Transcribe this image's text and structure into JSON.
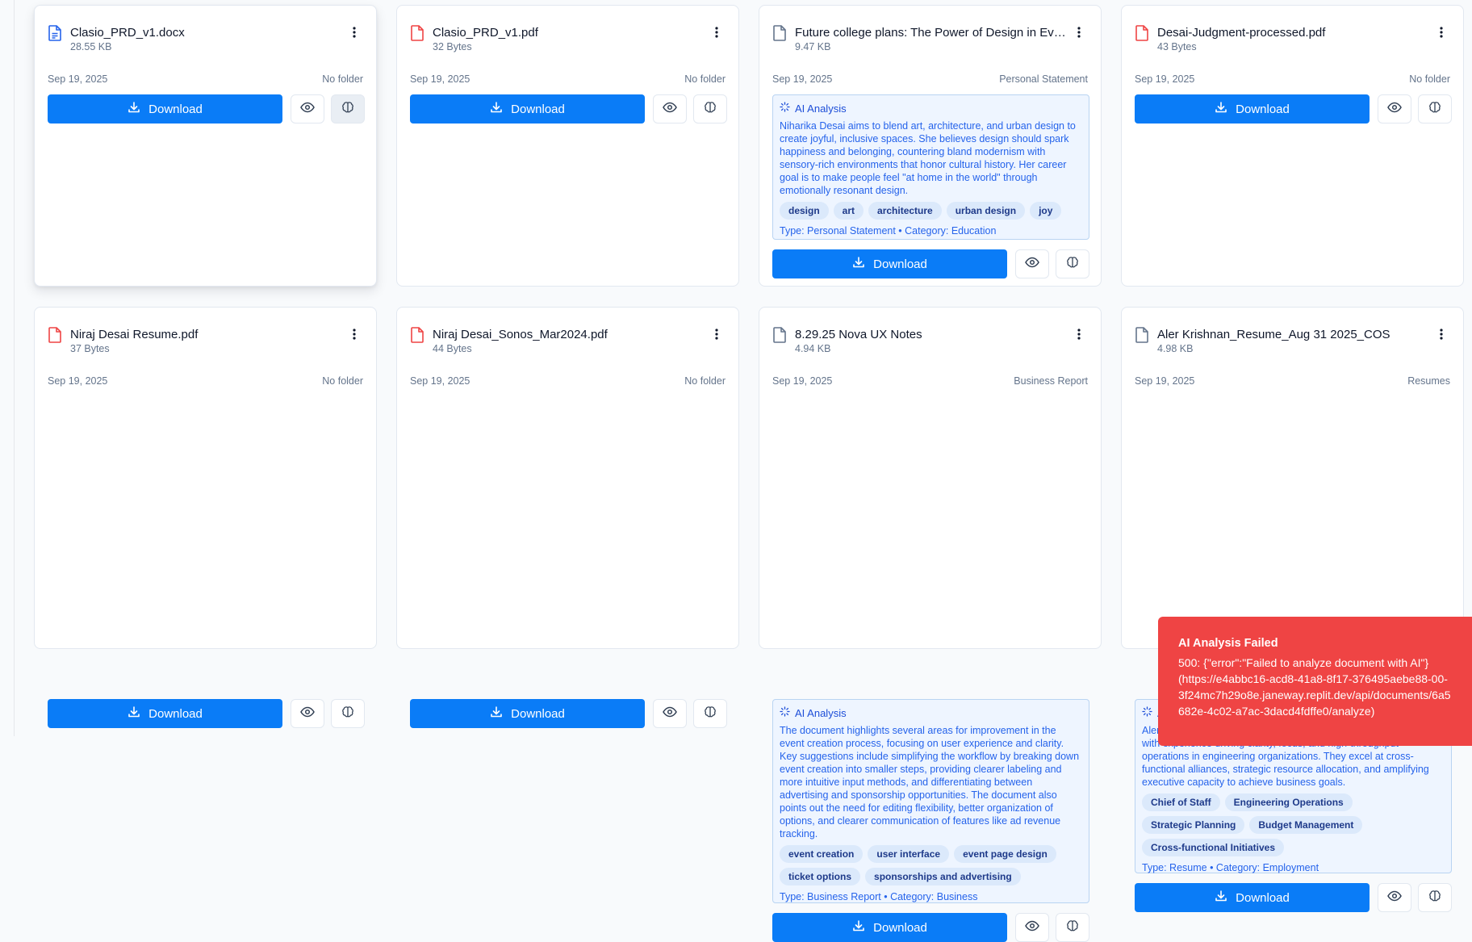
{
  "colors": {
    "accent": "#0a7cf7",
    "pdf_icon": "#ef4444",
    "doc_icon": "#2563eb",
    "generic_icon": "#64748b",
    "toast_bg": "#ef4444"
  },
  "cards": [
    {
      "name": "Clasio_PRD_v1.docx",
      "size": "28.55 KB",
      "icon": "doc-file-icon",
      "date": "Sep 19, 2025",
      "folder": "No folder",
      "download_label": "Download"
    },
    {
      "name": "Clasio_PRD_v1.pdf",
      "size": "32 Bytes",
      "icon": "pdf-file-icon",
      "date": "Sep 19, 2025",
      "folder": "No folder",
      "download_label": "Download"
    },
    {
      "name": "Future college plans: The Power of Design in Eve...",
      "size": "9.47 KB",
      "icon": "generic-file-icon",
      "date": "Sep 19, 2025",
      "folder": "Personal Statement",
      "download_label": "Download",
      "ai": {
        "heading": "AI Analysis",
        "summary": "Niharika Desai aims to blend art, architecture, and urban design to create joyful, inclusive spaces. She believes design should spark happiness and belonging, countering bland modernism with sensory-rich environments that honor cultural history. Her career goal is to make people feel \"at home in the world\" through emotionally resonant design.",
        "tags": [
          "design",
          "art",
          "architecture",
          "urban design",
          "joy"
        ],
        "meta": "Type: Personal Statement • Category: Education"
      }
    },
    {
      "name": "Desai-Judgment-processed.pdf",
      "size": "43 Bytes",
      "icon": "pdf-file-icon",
      "date": "Sep 19, 2025",
      "folder": "No folder",
      "download_label": "Download"
    },
    {
      "name": "Niraj Desai Resume.pdf",
      "size": "37 Bytes",
      "icon": "pdf-file-icon",
      "date": "Sep 19, 2025",
      "folder": "No folder",
      "download_label": "Download"
    },
    {
      "name": "Niraj Desai_Sonos_Mar2024.pdf",
      "size": "44 Bytes",
      "icon": "pdf-file-icon",
      "date": "Sep 19, 2025",
      "folder": "No folder",
      "download_label": "Download"
    },
    {
      "name": "8.29.25 Nova UX Notes",
      "size": "4.94 KB",
      "icon": "generic-file-icon",
      "date": "Sep 19, 2025",
      "folder": "Business Report",
      "download_label": "Download",
      "ai": {
        "heading": "AI Analysis",
        "summary": "The document highlights several areas for improvement in the event creation process, focusing on user experience and clarity. Key suggestions include simplifying the workflow by breaking down event creation into smaller steps, providing clearer labeling and more intuitive input methods, and differentiating between advertising and sponsorship opportunities. The document also points out the need for editing flexibility, better organization of options, and clearer communication of features like ad revenue tracking.",
        "tags": [
          "event creation",
          "user interface",
          "event page design",
          "ticket options",
          "sponsorships and advertising"
        ],
        "meta": "Type: Business Report • Category: Business"
      }
    },
    {
      "name": "Aler Krishnan_Resume_Aug 31 2025_COS",
      "size": "4.98 KB",
      "icon": "generic-file-icon",
      "date": "Sep 19, 2025",
      "folder": "Resumes",
      "download_label": "Download",
      "ai": {
        "heading": "AI Analysis",
        "summary": "Aler Krishnan is a Chief of Staff/Engineering Operations Leader with experience driving clarity, focus, and high-throughput operations in engineering organizations. They excel at cross-functional alliances, strategic resource allocation, and amplifying executive capacity to achieve business goals.",
        "tags": [
          "Chief of Staff",
          "Engineering Operations",
          "Strategic Planning",
          "Budget Management",
          "Cross-functional Initiatives"
        ],
        "meta": "Type: Resume • Category: Employment"
      }
    }
  ],
  "toast": {
    "title": "AI Analysis Failed",
    "message": "500: {\"error\":\"Failed to analyze document with AI\"}\n(https://e4abbc16-acd8-41a8-8f17-376495aebe88-00-\n3f24mc7h29o8e.janeway.replit.dev/api/documents/6a5\n682e-4c02-a7ac-3dacd4fdffe0/analyze)"
  }
}
